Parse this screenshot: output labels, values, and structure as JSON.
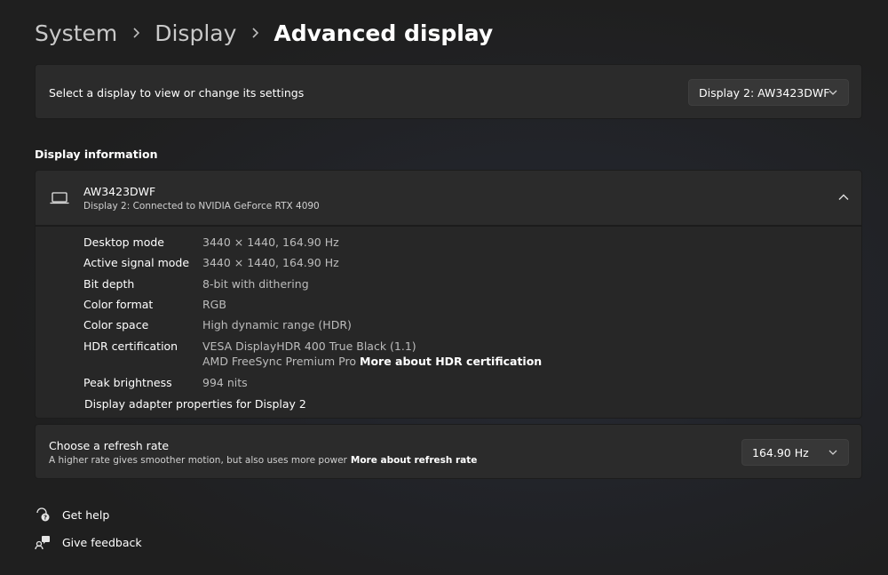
{
  "breadcrumb": {
    "items": [
      "System",
      "Display",
      "Advanced display"
    ]
  },
  "display_select": {
    "label": "Select a display to view or change its settings",
    "selected": "Display 2: AW3423DWF"
  },
  "display_info": {
    "section_title": "Display information",
    "name": "AW3423DWF",
    "subtitle": "Display 2: Connected to NVIDIA GeForce RTX 4090",
    "rows": [
      {
        "label": "Desktop mode",
        "value": "3440 × 1440, 164.90 Hz"
      },
      {
        "label": "Active signal mode",
        "value": "3440 × 1440, 164.90 Hz"
      },
      {
        "label": "Bit depth",
        "value": "8-bit with dithering"
      },
      {
        "label": "Color format",
        "value": "RGB"
      },
      {
        "label": "Color space",
        "value": "High dynamic range (HDR)"
      },
      {
        "label": "HDR certification",
        "value": "VESA DisplayHDR 400 True Black (1.1)",
        "value2": "AMD FreeSync Premium Pro",
        "link": "More about HDR certification"
      },
      {
        "label": "Peak brightness",
        "value": "994 nits"
      }
    ],
    "adapter_link": "Display adapter properties for Display 2"
  },
  "refresh": {
    "title": "Choose a refresh rate",
    "subtitle": "A higher rate gives smoother motion, but also uses more power",
    "link": "More about refresh rate",
    "selected": "164.90 Hz"
  },
  "footer": {
    "help": "Get help",
    "feedback": "Give feedback"
  }
}
